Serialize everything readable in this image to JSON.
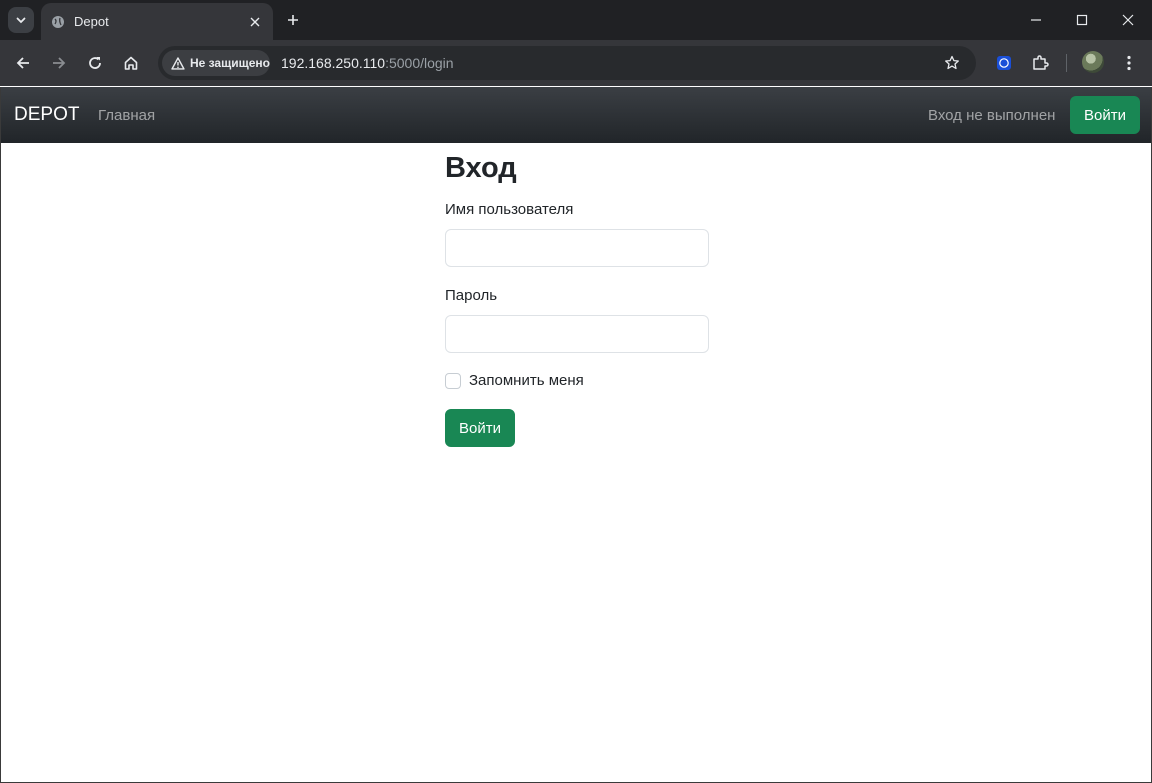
{
  "browser": {
    "tab_title": "Depot",
    "security_label": "Не защищено",
    "url_host": "192.168.250.110",
    "url_path": ":5000/login"
  },
  "navbar": {
    "brand": "DEPOT",
    "home_link": "Главная",
    "status_text": "Вход не выполнен",
    "login_button": "Войти"
  },
  "form": {
    "title": "Вход",
    "username_label": "Имя пользователя",
    "username_value": "",
    "password_label": "Пароль",
    "password_value": "",
    "remember_label": "Запомнить меня",
    "remember_checked": false,
    "submit_label": "Войти"
  },
  "colors": {
    "accent_green": "#198754",
    "navbar_dark": "#212529",
    "chrome_dark": "#202124"
  },
  "icons": [
    "tab-search-icon",
    "globe-icon",
    "close-icon",
    "plus-icon",
    "minimize-icon",
    "maximize-icon",
    "back-icon",
    "forward-icon",
    "reload-icon",
    "home-icon",
    "warning-icon",
    "star-icon",
    "messenger-extension-icon",
    "puzzle-icon",
    "kebab-menu-icon"
  ]
}
